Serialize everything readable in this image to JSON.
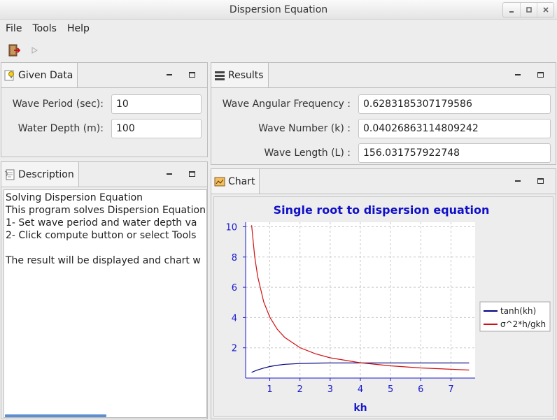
{
  "window": {
    "title": "Dispersion Equation"
  },
  "menu": [
    "File",
    "Tools",
    "Help"
  ],
  "toolbar": {
    "exit_icon": "exit-door-icon",
    "run_icon": "play-icon"
  },
  "given": {
    "tab_label": "Given Data",
    "period_label": "Wave Period (sec):",
    "period_value": "10",
    "depth_label": "Water Depth (m):",
    "depth_value": "100"
  },
  "results": {
    "tab_label": "Results",
    "freq_label": "Wave Angular Frequency :",
    "freq_value": "0.6283185307179586",
    "k_label": "Wave Number (k) :",
    "k_value": "0.04026863114809242",
    "L_label": "Wave Length (L) :",
    "L_value": "156.031757922748"
  },
  "description": {
    "tab_label": "Description",
    "lines": [
      "Solving Dispersion Equation",
      "This program solves Dispersion Equation",
      "1- Set wave period and water depth va",
      "2- Click compute button or select Tools",
      "",
      "The result will be displayed and chart w"
    ]
  },
  "chart": {
    "tab_label": "Chart",
    "colors": {
      "title": "#1010c8",
      "tanh": "#000080",
      "ratio": "#d01010",
      "axis": "#1a1acc"
    }
  },
  "chart_data": {
    "type": "line",
    "title": "Single root to dispersion equation",
    "xlabel": "kh",
    "ylabel": "",
    "xlim": [
      0.2,
      7.8
    ],
    "ylim": [
      0,
      10.3
    ],
    "xticks": [
      1,
      2,
      3,
      4,
      5,
      6,
      7
    ],
    "yticks": [
      2,
      4,
      6,
      8,
      10
    ],
    "grid": true,
    "legend_position": "right",
    "series": [
      {
        "name": "tanh(kh)",
        "x": [
          0.4,
          0.5,
          0.6,
          0.8,
          1.0,
          1.25,
          1.5,
          2.0,
          2.5,
          3.0,
          4.0,
          5.0,
          6.0,
          7.0,
          7.6
        ],
        "values": [
          0.38,
          0.46,
          0.54,
          0.66,
          0.76,
          0.85,
          0.91,
          0.96,
          0.99,
          1.0,
          1.0,
          1.0,
          1.0,
          1.0,
          1.0
        ]
      },
      {
        "name": "σ^2*h/gkh",
        "x": [
          0.4,
          0.5,
          0.6,
          0.8,
          1.0,
          1.25,
          1.5,
          2.0,
          2.5,
          3.0,
          4.0,
          5.0,
          6.0,
          7.0,
          7.6
        ],
        "values": [
          10.1,
          8.05,
          6.7,
          5.03,
          4.03,
          3.22,
          2.68,
          2.01,
          1.61,
          1.34,
          1.01,
          0.81,
          0.67,
          0.58,
          0.53
        ]
      }
    ]
  }
}
